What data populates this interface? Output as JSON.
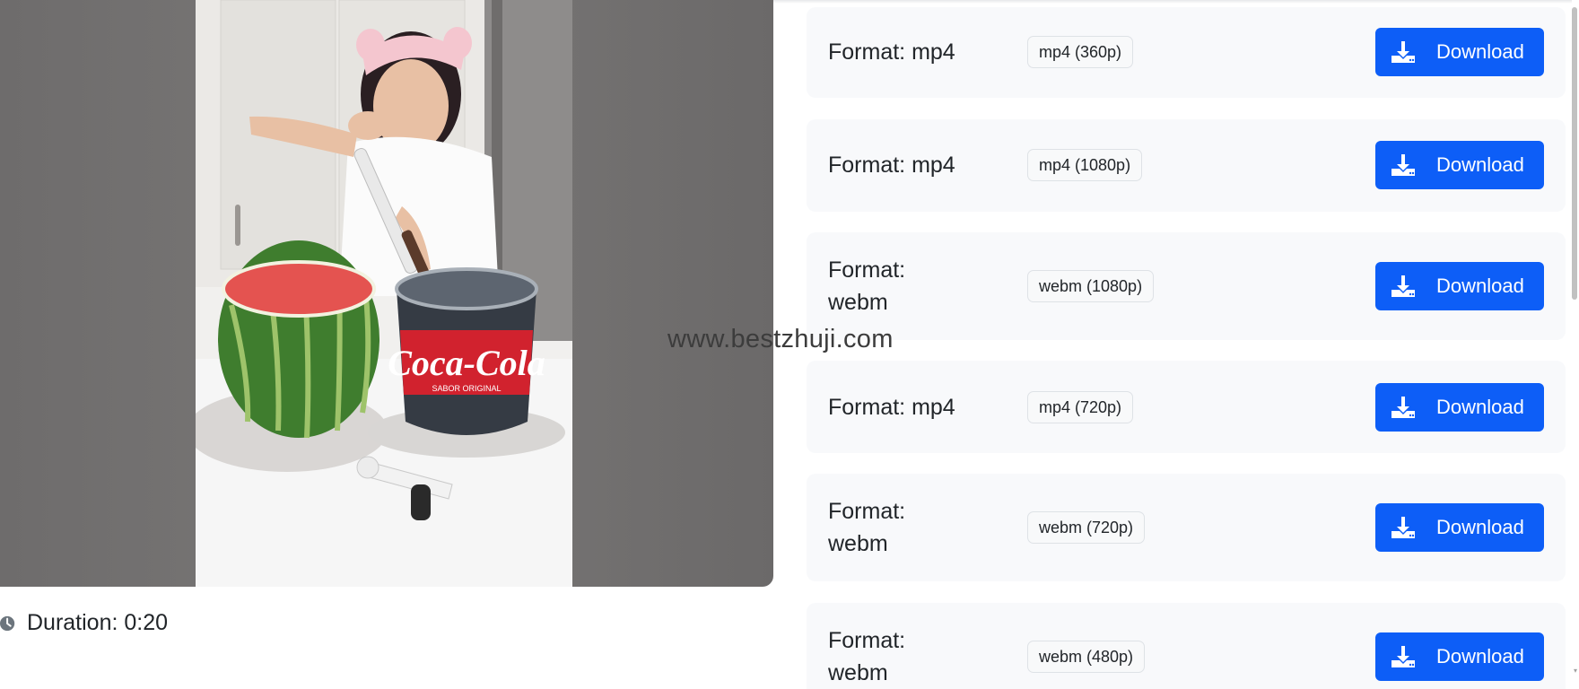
{
  "preview": {
    "duration_text": "Duration: 0:20",
    "image_alt": "Video thumbnail"
  },
  "watermark": "www.bestzhuji.com",
  "formats": [
    {
      "label": "Format: mp4",
      "quality": "mp4 (360p)",
      "button": "Download"
    },
    {
      "label": "Format: mp4",
      "quality": "mp4 (1080p)",
      "button": "Download"
    },
    {
      "label": "Format: webm",
      "quality": "webm (1080p)",
      "button": "Download"
    },
    {
      "label": "Format: mp4",
      "quality": "mp4 (720p)",
      "button": "Download"
    },
    {
      "label": "Format: webm",
      "quality": "webm (720p)",
      "button": "Download"
    },
    {
      "label": "Format: webm",
      "quality": "webm (480p)",
      "button": "Download"
    }
  ],
  "colors": {
    "accent": "#0d5ef7",
    "card_bg": "#f8f9fb",
    "badge_border": "#dee2e6"
  },
  "icons": {
    "download": "download-icon",
    "clock": "clock-icon"
  }
}
